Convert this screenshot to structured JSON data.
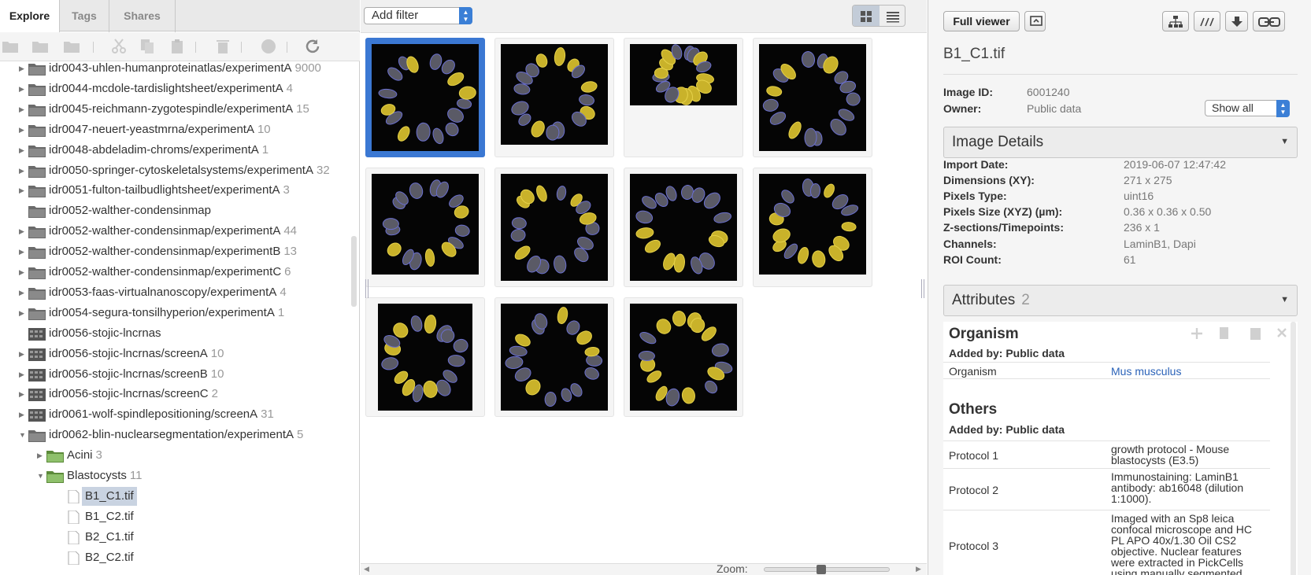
{
  "left": {
    "tabs": [
      "Explore",
      "Tags",
      "Shares"
    ],
    "tree": [
      {
        "label": "idr0043-uhlen-humanproteinatlas/experimentA",
        "count": "9000",
        "icon": "folder-dark-icon",
        "arrow": "right"
      },
      {
        "label": "idr0044-mcdole-tardislightsheet/experimentA",
        "count": "4",
        "icon": "folder-dark-icon",
        "arrow": "right"
      },
      {
        "label": "idr0045-reichmann-zygotespindle/experimentA",
        "count": "15",
        "icon": "folder-dark-icon",
        "arrow": "right"
      },
      {
        "label": "idr0047-neuert-yeastmrna/experimentA",
        "count": "10",
        "icon": "folder-dark-icon",
        "arrow": "right"
      },
      {
        "label": "idr0048-abdeladim-chroms/experimentA",
        "count": "1",
        "icon": "folder-dark-icon",
        "arrow": "right"
      },
      {
        "label": "idr0050-springer-cytoskeletalsystems/experimentA",
        "count": "32",
        "icon": "folder-dark-icon",
        "arrow": "right"
      },
      {
        "label": "idr0051-fulton-tailbudlightsheet/experimentA",
        "count": "3",
        "icon": "folder-dark-icon",
        "arrow": "right"
      },
      {
        "label": "idr0052-walther-condensinmap",
        "count": "",
        "icon": "folder-dark-icon",
        "arrow": ""
      },
      {
        "label": "idr0052-walther-condensinmap/experimentA",
        "count": "44",
        "icon": "folder-dark-icon",
        "arrow": "right"
      },
      {
        "label": "idr0052-walther-condensinmap/experimentB",
        "count": "13",
        "icon": "folder-dark-icon",
        "arrow": "right"
      },
      {
        "label": "idr0052-walther-condensinmap/experimentC",
        "count": "6",
        "icon": "folder-dark-icon",
        "arrow": "right"
      },
      {
        "label": "idr0053-faas-virtualnanoscopy/experimentA",
        "count": "4",
        "icon": "folder-dark-icon",
        "arrow": "right"
      },
      {
        "label": "idr0054-segura-tonsilhyperion/experimentA",
        "count": "1",
        "icon": "folder-dark-icon",
        "arrow": "right"
      },
      {
        "label": "idr0056-stojic-lncrnas",
        "count": "",
        "icon": "screen-icon",
        "arrow": ""
      },
      {
        "label": "idr0056-stojic-lncrnas/screenA",
        "count": "10",
        "icon": "screen-icon",
        "arrow": "right"
      },
      {
        "label": "idr0056-stojic-lncrnas/screenB",
        "count": "10",
        "icon": "screen-icon",
        "arrow": "right"
      },
      {
        "label": "idr0056-stojic-lncrnas/screenC",
        "count": "2",
        "icon": "screen-icon",
        "arrow": "right"
      },
      {
        "label": "idr0061-wolf-spindlepositioning/screenA",
        "count": "31",
        "icon": "screen-icon",
        "arrow": "right"
      },
      {
        "label": "idr0062-blin-nuclearsegmentation/experimentA",
        "count": "5",
        "icon": "folder-dark-icon",
        "arrow": "down"
      },
      {
        "label": "Acini",
        "count": "3",
        "icon": "folder-green-icon",
        "arrow": "right",
        "indent": 1
      },
      {
        "label": "Blastocysts",
        "count": "11",
        "icon": "folder-green-icon",
        "arrow": "down",
        "indent": 1
      },
      {
        "label": "B1_C1.tif",
        "count": "",
        "icon": "image-file-icon",
        "arrow": "",
        "indent": 2,
        "selected": true
      },
      {
        "label": "B1_C2.tif",
        "count": "",
        "icon": "image-file-icon",
        "arrow": "",
        "indent": 2
      },
      {
        "label": "B2_C1.tif",
        "count": "",
        "icon": "image-file-icon",
        "arrow": "",
        "indent": 2
      },
      {
        "label": "B2_C2.tif",
        "count": "",
        "icon": "image-file-icon",
        "arrow": "",
        "indent": 2
      }
    ]
  },
  "center": {
    "filter_label": "Add filter",
    "zoom_label": "Zoom:",
    "zoom_level": 0.5,
    "thumbnails": [
      {
        "shape": "square",
        "selected": true
      },
      {
        "shape": "wide"
      },
      {
        "shape": "short"
      },
      {
        "shape": "square"
      },
      {
        "shape": "wide"
      },
      {
        "shape": "square"
      },
      {
        "shape": "square"
      },
      {
        "shape": "wide"
      },
      {
        "shape": "narrow"
      },
      {
        "shape": "square"
      },
      {
        "shape": "square"
      }
    ]
  },
  "right": {
    "full_viewer": "Full viewer",
    "title": "B1_C1.tif",
    "image_id_label": "Image ID:",
    "image_id": "6001240",
    "owner_label": "Owner:",
    "owner": "Public data",
    "show_all": "Show all",
    "image_details_title": "Image Details",
    "details": [
      {
        "label": "Import Date:",
        "value": "2019-06-07 12:47:42"
      },
      {
        "label": "Dimensions (XY):",
        "value": "271 x 275"
      },
      {
        "label": "Pixels Type:",
        "value": "uint16"
      },
      {
        "label": "Pixels Size (XYZ) (µm):",
        "value": "0.36 x 0.36 x 0.50"
      },
      {
        "label": "Z-sections/Timepoints:",
        "value": "236 x 1"
      },
      {
        "label": "Channels:",
        "value": "LaminB1, Dapi"
      },
      {
        "label": "ROI Count:",
        "value": "61"
      }
    ],
    "attributes_title": "Attributes",
    "attributes_count": "2",
    "organism_title": "Organism",
    "organism_added_by": "Added by: Public data",
    "organism_key": "Organism",
    "organism_value": "Mus musculus",
    "others_title": "Others",
    "others_added_by": "Added by: Public data",
    "protocols": [
      {
        "key": "Protocol 1",
        "value": "growth protocol - Mouse blastocysts (E3.5)"
      },
      {
        "key": "Protocol 2",
        "value": "Immunostaining: LaminB1 antibody: ab16048 (dilution 1:1000)."
      },
      {
        "key": "Protocol 3",
        "value": "Imaged with an Sp8 leica confocal microscope and HC PL APO 40x/1.30 Oil CS2 objective. Nuclear features were extracted in PickCells using manually segmented"
      }
    ]
  },
  "colors": {
    "accent": "#3b78d3",
    "link": "#2a62b8",
    "nucleus_yellow": "#c9b22a",
    "nucleus_blue": "#6a6fd0"
  }
}
